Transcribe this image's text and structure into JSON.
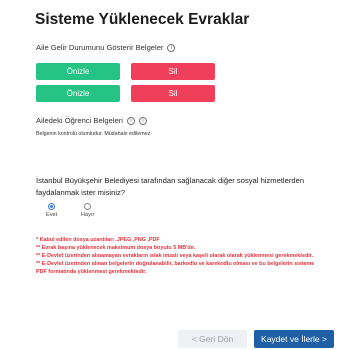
{
  "header": {
    "title": "Sisteme Yüklenecek Evraklar"
  },
  "family_income": {
    "label": "Aile Gelir Durumunu Gösterir Belgeler",
    "rows": [
      {
        "view_label": "Önizle",
        "delete_label": "Sil"
      },
      {
        "view_label": "Önizle",
        "delete_label": "Sil"
      }
    ]
  },
  "student_docs": {
    "label": "Ailedeki Öğrenci Belgeleri",
    "note": "Belgenin kontrolü olumludur. Müdahale edilemez."
  },
  "social_services": {
    "question": "İstanbul Büyükşehir Belediyesi tarafından sağlanacak diğer sosyal hizmetlerden faydalanmak ister misiniz?",
    "options": [
      {
        "label": "Evet",
        "checked": true
      },
      {
        "label": "Hayır",
        "checked": false
      }
    ]
  },
  "warnings": [
    "* Kabul edilen dosya uzantıları .JPEG ,PNG ,PDF",
    "** Evrak başına yüklenecek maksimum dosya boyutu 5 MB'dır.",
    "** E-Devlet üzerinden alınamayan evrakların ıslak imzalı veya kaşeli olarak olarak yüklenmesi gerekmektedir.",
    "** E-Devlet üzerinden alınan belgelerin doğrulanabilir, barkodlu ve karekodlu olması ve bu belgelerin sisteme PDF formatında yüklenmesi gerekmektedir."
  ],
  "footer": {
    "back_label": "< Geri Dön",
    "next_label": "Kaydet ve İlerle >"
  },
  "icons": {
    "info": "info-circle-icon"
  },
  "colors": {
    "view_button": "#25c384",
    "delete_button": "#ef3f5a",
    "warning_text": "#e0333c",
    "primary_button": "#1f5fa6",
    "radio_accent": "#3b7be3"
  }
}
